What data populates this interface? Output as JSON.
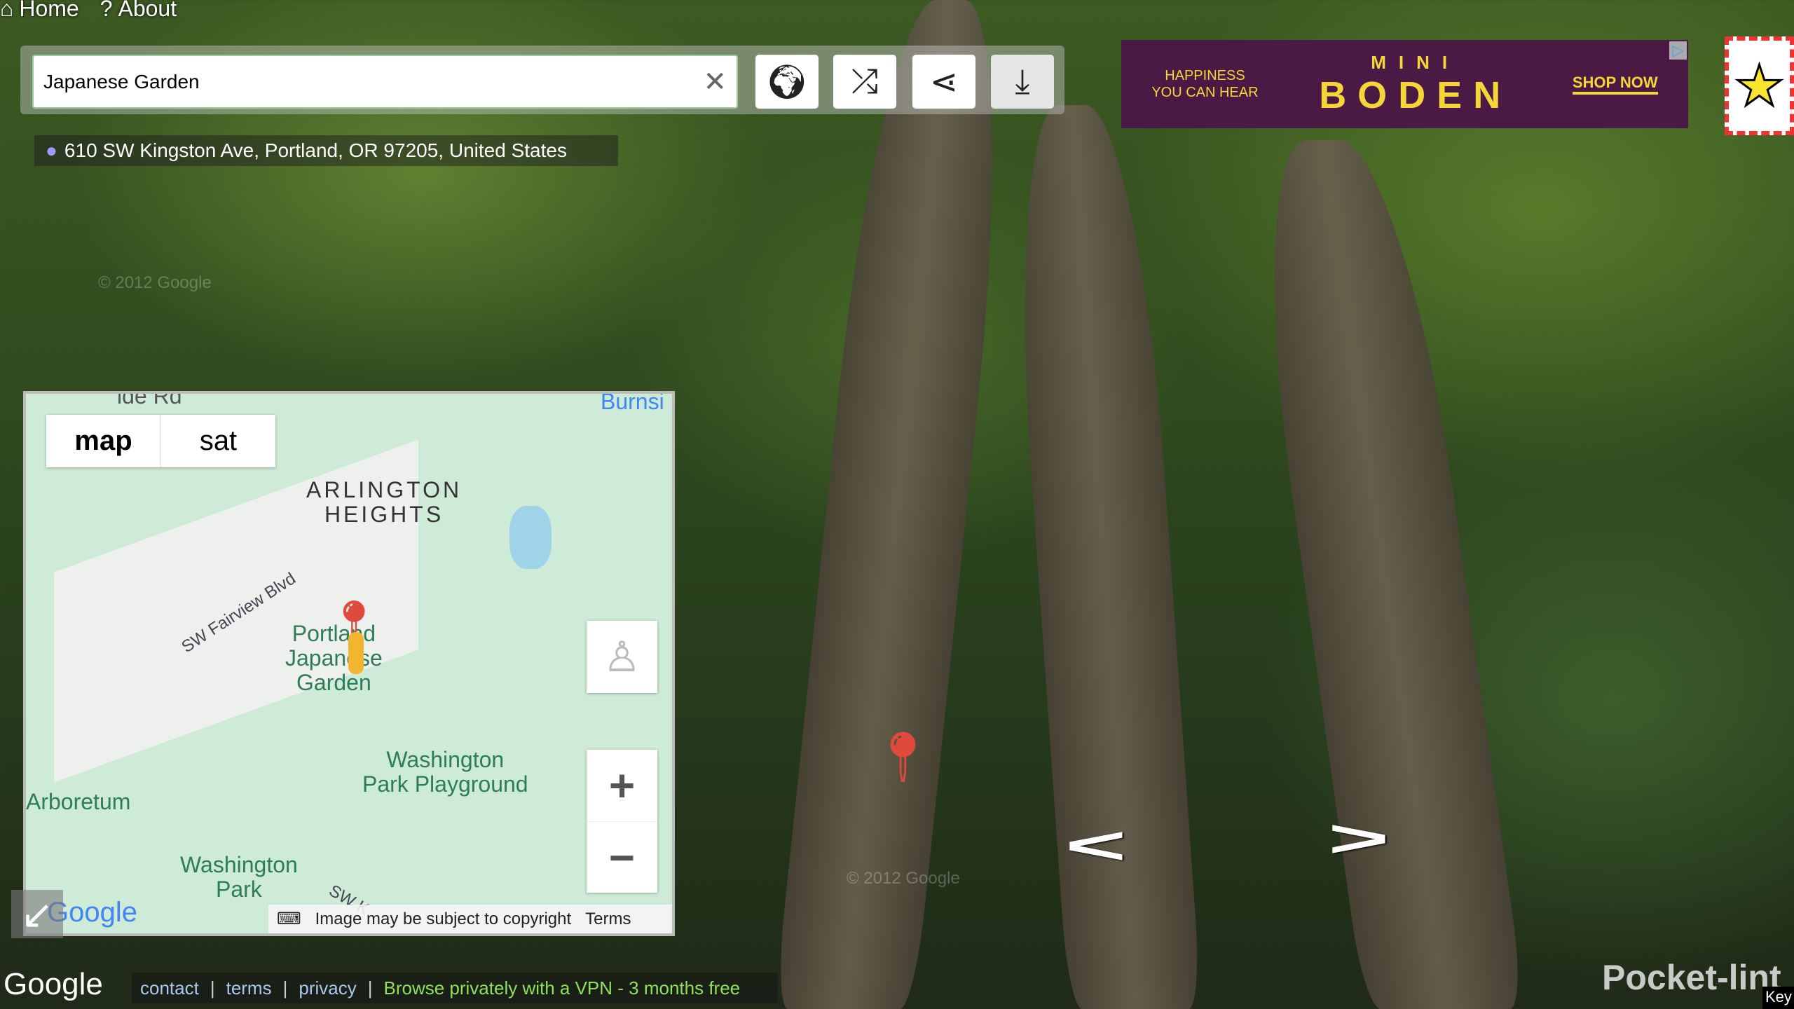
{
  "nav": {
    "home": "Home",
    "about": "About"
  },
  "search": {
    "value": "Japanese Garden",
    "clear_icon": "close-icon"
  },
  "toolbar": {
    "buttons": [
      {
        "name": "globe",
        "icon": "globe-icon"
      },
      {
        "name": "random",
        "icon": "shuffle-icon"
      },
      {
        "name": "share",
        "icon": "share-icon"
      },
      {
        "name": "download",
        "icon": "download-icon"
      }
    ]
  },
  "address": "610 SW Kingston Ave, Portland, OR 97205, United States",
  "ad": {
    "tagline_1": "HAPPINESS",
    "tagline_2": "YOU CAN HEAR",
    "brand_top": "MINI",
    "brand": "BODEN",
    "cta": "SHOP NOW",
    "bg": "#4a1a45",
    "fg": "#f5d638"
  },
  "map": {
    "tabs": [
      "map",
      "sat"
    ],
    "active_tab": "map",
    "labels": {
      "arlington": "ARLINGTON\nHEIGHTS",
      "fairview": "SW Fairview Blvd",
      "garden": "Portland\nJapanese\nGarden",
      "playground": "Washington\nPark Playground",
      "arboretum": "Arboretum",
      "park": "Washington\nPark",
      "road_top": "ide Rd",
      "burnside": "Burnsi",
      "sw_k": "SW K"
    },
    "logo": "Google",
    "copyright": "Image may be subject to copyright",
    "terms": "Terms"
  },
  "streetview": {
    "watermark": "© 2012 Google"
  },
  "footer": {
    "logo": "Google",
    "links": [
      "contact",
      "terms",
      "privacy"
    ],
    "promo": "Browse privately with a VPN - 3 months free"
  },
  "overlay": {
    "brand": "Pocket-lint",
    "key": "Key"
  }
}
